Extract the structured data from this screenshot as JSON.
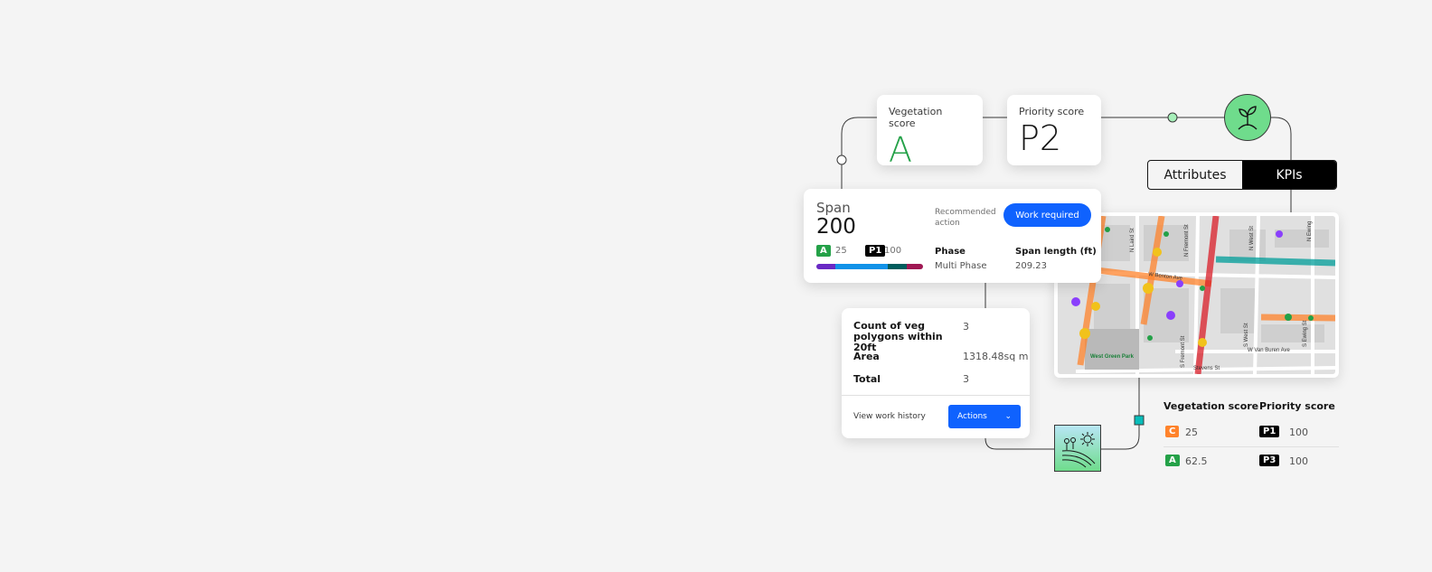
{
  "veg_card": {
    "label": "Vegetation score",
    "value": "A",
    "color": "#24a148"
  },
  "priority_card": {
    "label": "Priority score",
    "value": "P2"
  },
  "toggle": {
    "tabs": [
      "Attributes",
      "KPIs"
    ],
    "active": "KPIs"
  },
  "span_card": {
    "title": "Span",
    "value": "200",
    "veg_badge": "A",
    "veg_value": "25",
    "priority_badge": "P1",
    "priority_value": "100",
    "recommended_label": "Recommended action",
    "action_button": "Work required",
    "phase_label": "Phase",
    "phase_value": "Multi Phase",
    "length_label": "Span length (ft)",
    "length_value": "209.23",
    "bar_colors": [
      "#6929c4",
      "#1192e8",
      "#005d5d",
      "#9f1853"
    ]
  },
  "details_card": {
    "rows": [
      {
        "label": "Count of veg polygons within 20ft",
        "value": "3"
      },
      {
        "label": "Area",
        "value": "1318.48sq m"
      },
      {
        "label": "Total",
        "value": "3"
      }
    ],
    "link": "View work history",
    "actions_button": "Actions"
  },
  "map": {
    "streets": [
      "N Laird St",
      "N Fremont St",
      "N West St",
      "N Ewing",
      "W Benton Ave",
      "S Fremont St",
      "S West St",
      "S Ewing St",
      "W Van Buren Ave",
      "Stevens St",
      "West Green Park"
    ]
  },
  "table": {
    "headers": [
      "Vegetation score",
      "Priority score"
    ],
    "rows": [
      {
        "veg": "C",
        "veg_value": "25",
        "priority": "P1",
        "priority_value": "100"
      },
      {
        "veg": "A",
        "veg_value": "62.5",
        "priority": "P3",
        "priority_value": "100"
      }
    ]
  },
  "icons": [
    "plant-icon",
    "landscape-sun-icon"
  ],
  "colors": {
    "accent": "#0f62fe",
    "plant_circle": "#6fdc8c"
  }
}
